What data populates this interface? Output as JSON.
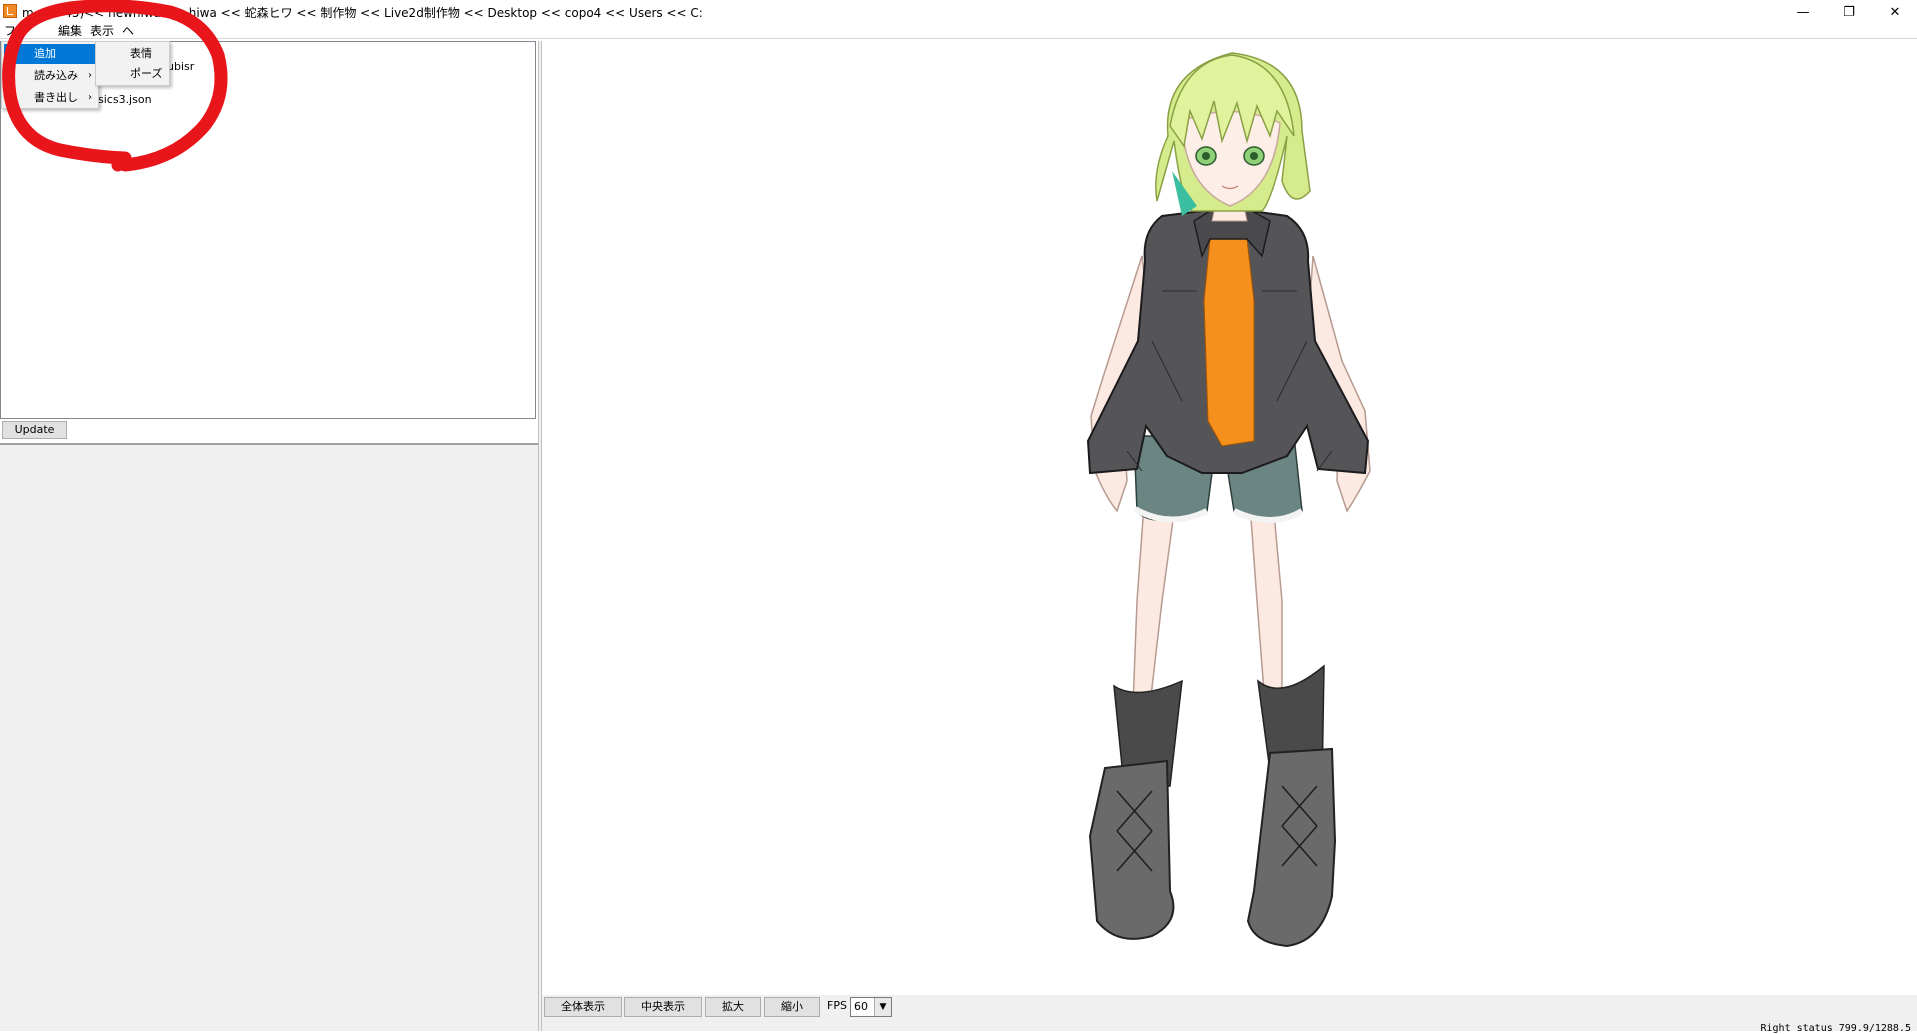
{
  "window": {
    "title": "m              ... 4 45)<< newhiwa << hiwa << 蛇森ヒワ << 制作物 << Live2d制作物 << Desktop << copo4 << Users << C:",
    "minimize": "—",
    "maximize": "❐",
    "close": "✕"
  },
  "menubar": [
    "ファ",
    "編集",
    "表示",
    "ヘ"
  ],
  "menu": {
    "items": [
      {
        "label": "追加",
        "arrow": "",
        "highlighted": true
      },
      {
        "label": "読み込み",
        "arrow": "›"
      },
      {
        "label": "書き出し",
        "arrow": "›"
      }
    ],
    "submenu": [
      "表情",
      "ポーズ"
    ]
  },
  "tree": {
    "items": [
      "ubisr",
      "sics3.json"
    ]
  },
  "update_label": "Update",
  "toolbar": {
    "buttons": [
      "全体表示",
      "中央表示",
      "拡大",
      "縮小"
    ],
    "fps_label": "FPS",
    "fps_value": "60"
  },
  "status": "Right status  799.9/1288.5",
  "colors": {
    "highlight": "#0078d7",
    "annotation": "#e8161b",
    "panel_bg": "#f0f0f0"
  }
}
